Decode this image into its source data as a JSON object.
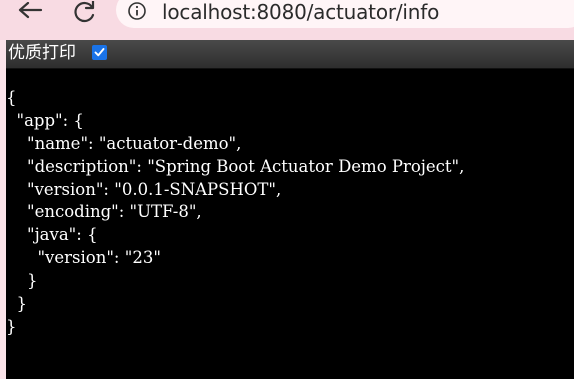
{
  "browser": {
    "url": "localhost:8080/actuator/info"
  },
  "print_bar": {
    "label": "优质打印",
    "checked": true
  },
  "json_lines": [
    "{",
    "  \"app\": {",
    "    \"name\": \"actuator-demo\",",
    "    \"description\": \"Spring Boot Actuator Demo Project\",",
    "    \"version\": \"0.0.1-SNAPSHOT\",",
    "    \"encoding\": \"UTF-8\",",
    "    \"java\": {",
    "      \"version\": \"23\"",
    "    }",
    "  }",
    "}"
  ],
  "colors": {
    "chrome_bg": "#f8dbe3",
    "page_bg": "#000000",
    "text": "#ffffff",
    "checkbox": "#1a73e8"
  }
}
